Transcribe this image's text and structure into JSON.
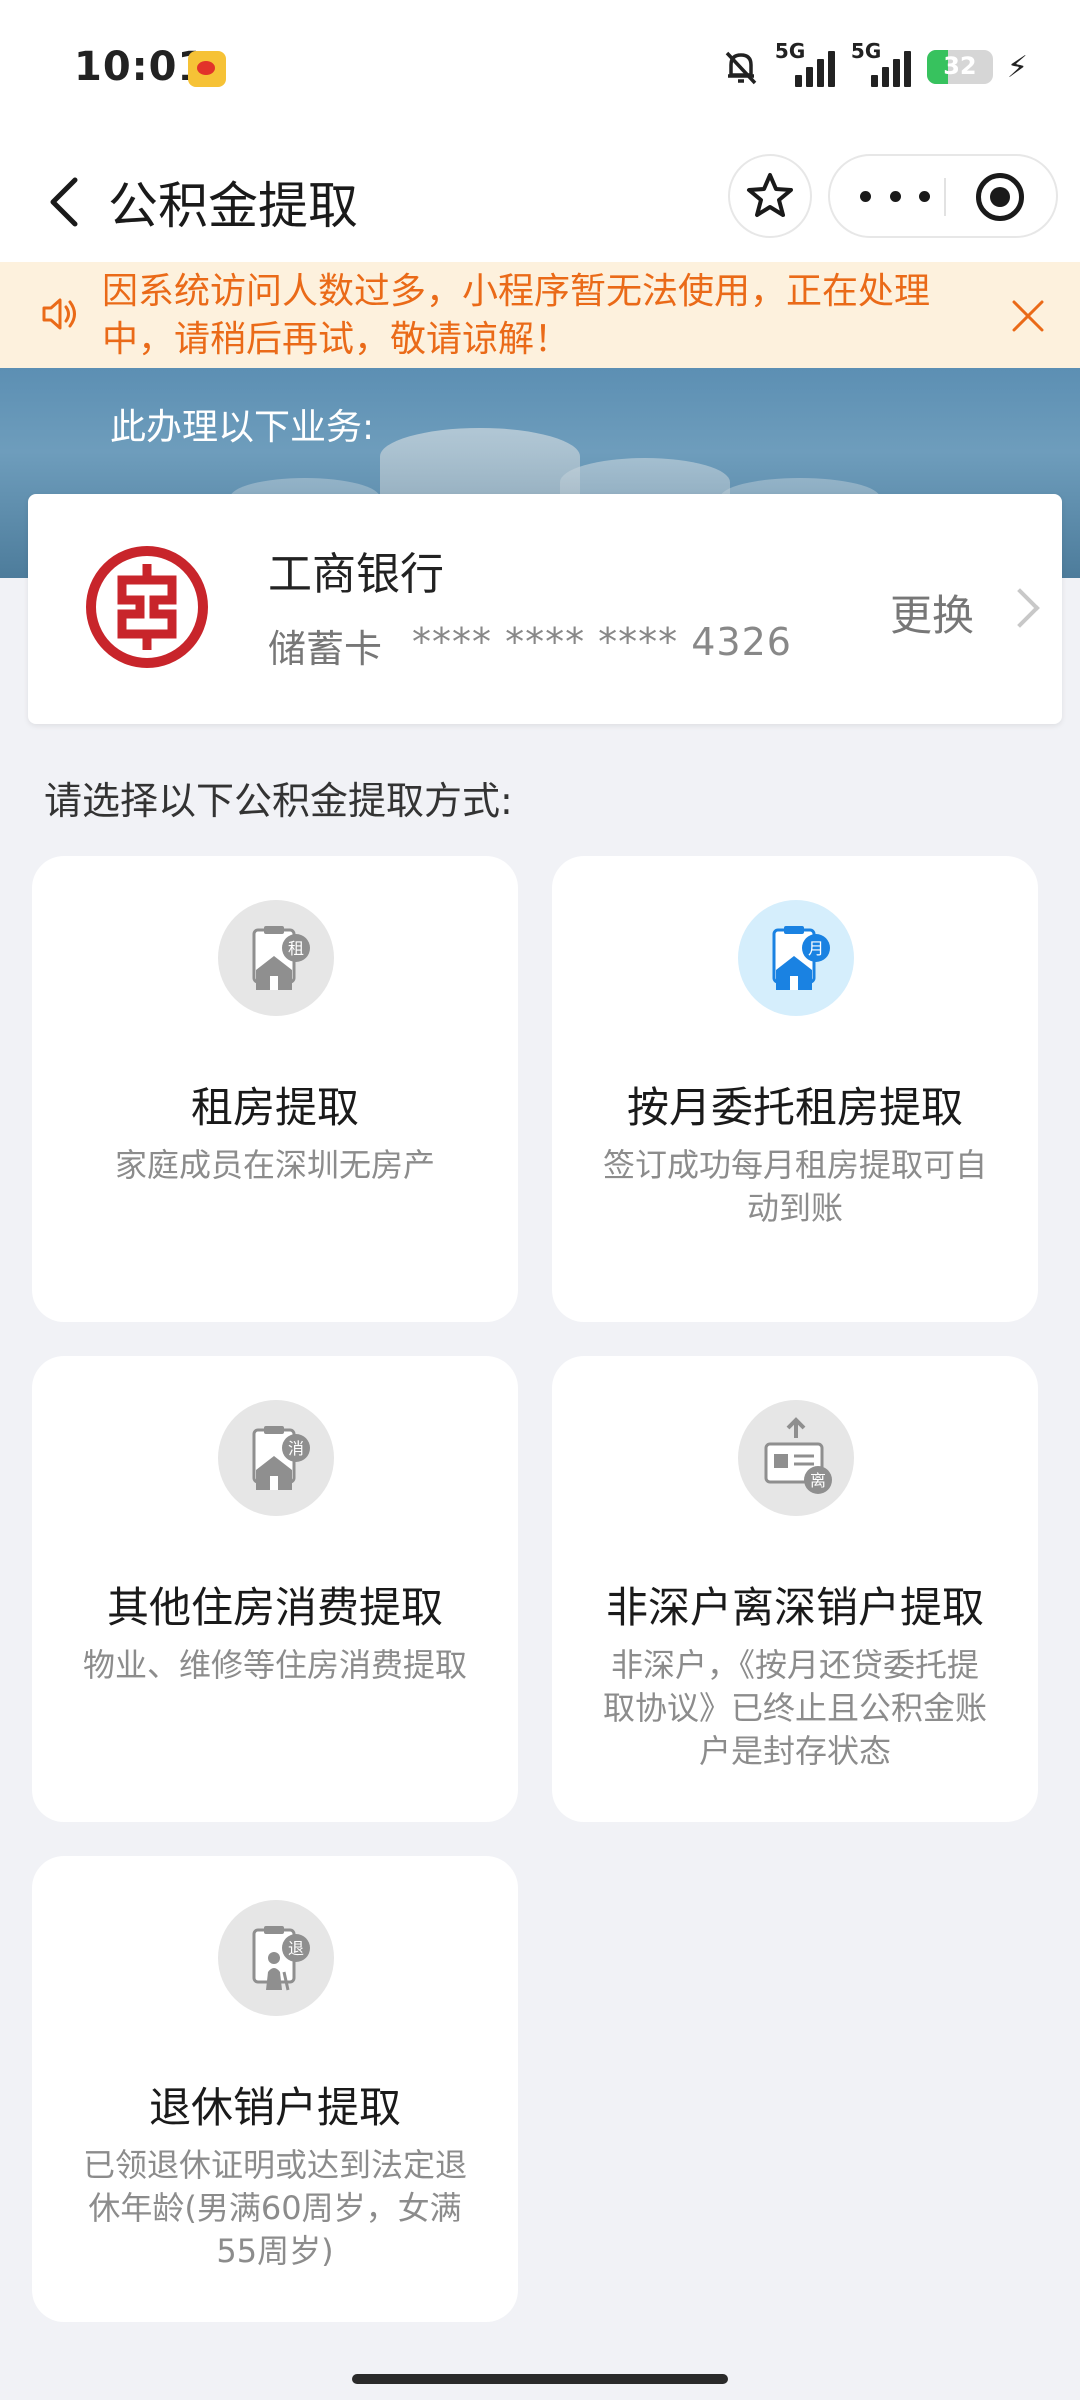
{
  "status_bar": {
    "time": "10:01",
    "signal_1": "5G",
    "signal_2": "5G",
    "battery": "32",
    "battery_level": 0.32,
    "icons": [
      "weibo-icon",
      "mute-bell-icon",
      "signal-icon",
      "battery-icon",
      "charging-icon"
    ]
  },
  "nav": {
    "title": "公积金提取",
    "icons": [
      "back-icon",
      "star-icon",
      "more-icon",
      "target-icon"
    ]
  },
  "notice": {
    "text": "因系统访问人数过多，小程序暂无法使用，正在处理中，请稍后再试，敬请谅解！",
    "icons": [
      "speaker-icon",
      "close-icon"
    ],
    "color": "#ea6a18"
  },
  "banner": {
    "text": "此办理以下业务:"
  },
  "bank_card": {
    "bank_name": "工商银行",
    "card_type": "储蓄卡",
    "card_number": "**** **** **** 4326",
    "change_label": "更换",
    "brand_color": "#c8252b"
  },
  "section_title": "请选择以下公积金提取方式:",
  "options": [
    {
      "title": "租房提取",
      "desc": "家庭成员在深圳无房产",
      "badge": "租",
      "icon": "rent-house-icon"
    },
    {
      "title": "按月委托租房提取",
      "desc": "签订成功每月租房提取可自动到账",
      "badge": "月",
      "icon": "monthly-rent-icon"
    },
    {
      "title": "其他住房消费提取",
      "desc": "物业、维修等住房消费提取",
      "badge": "消",
      "icon": "housing-consumption-icon"
    },
    {
      "title": "非深户离深销户提取",
      "desc": "非深户，《按月还贷委托提取协议》已终止且公积金账户是封存状态",
      "badge": "离",
      "icon": "leave-shenzhen-icon"
    },
    {
      "title": "退休销户提取",
      "desc": "已领退休证明或达到法定退休年龄(男满60周岁，女满55周岁)",
      "badge": "退",
      "icon": "retirement-icon"
    }
  ]
}
